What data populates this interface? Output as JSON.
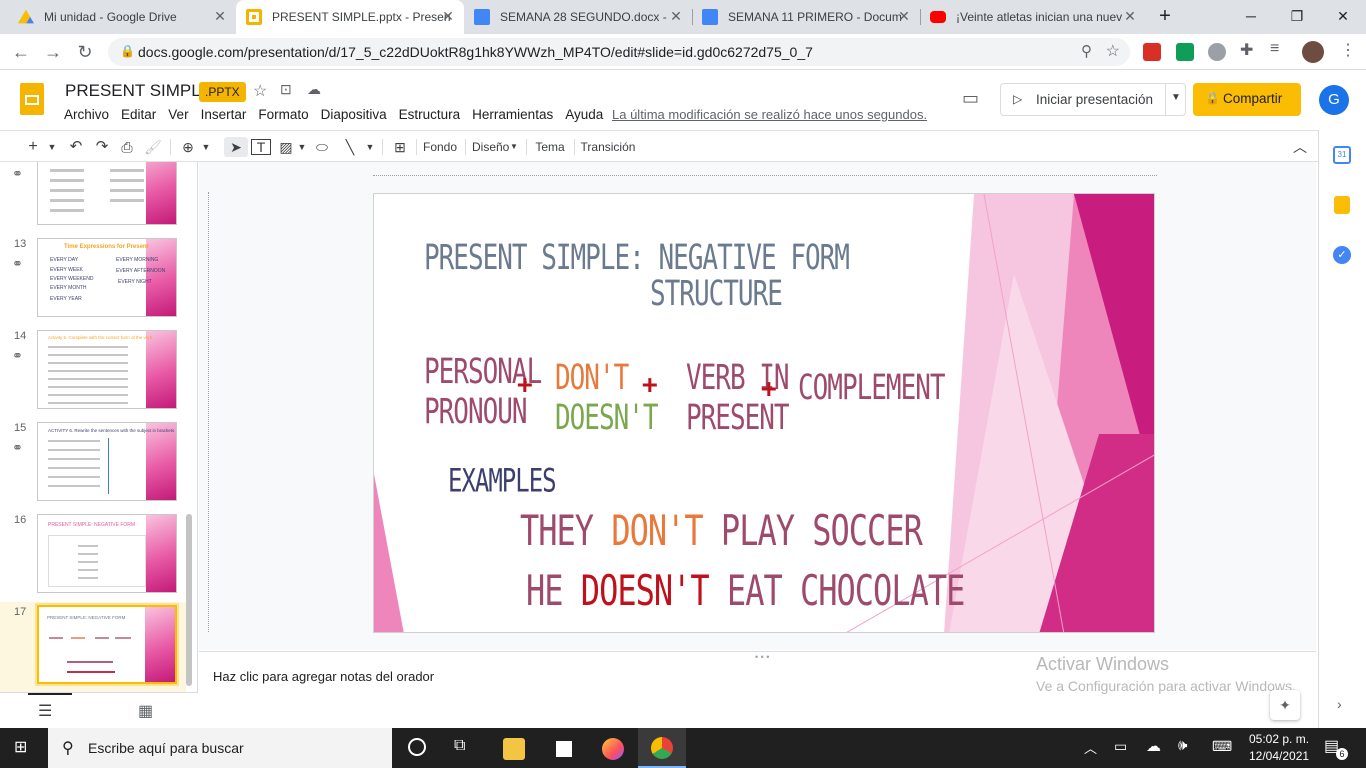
{
  "browser": {
    "tabs": [
      {
        "title": "Mi unidad - Google Drive",
        "icon": "google-drive-icon",
        "active": false
      },
      {
        "title": "PRESENT SIMPLE.pptx - Presen",
        "icon": "google-slides-icon",
        "active": true
      },
      {
        "title": "SEMANA 28 SEGUNDO.docx -",
        "icon": "google-docs-icon",
        "active": false
      },
      {
        "title": "SEMANA 11 PRIMERO - Docum",
        "icon": "google-docs-icon",
        "active": false
      },
      {
        "title": "¡Veinte atletas inician una nuev",
        "icon": "youtube-icon",
        "active": false
      }
    ],
    "new_tab": "+",
    "url": "docs.google.com/presentation/d/17_5_c22dDUoktR8g1hk8YWWzh_MP4TO/edit#slide=id.gd0c6272d75_0_7"
  },
  "doc": {
    "title": "PRESENT SIMPLE",
    "badge": ".PPTX",
    "menu": [
      "Archivo",
      "Editar",
      "Ver",
      "Insertar",
      "Formato",
      "Diapositiva",
      "Estructura",
      "Herramientas",
      "Ayuda"
    ],
    "last_edit": "La última modificación se realizó hace unos segundos.",
    "present_label": "Iniciar presentación",
    "share_label": "Compartir",
    "avatar_letter": "G"
  },
  "toolbar": {
    "fondo": "Fondo",
    "diseno": "Diseño",
    "tema": "Tema",
    "transicion": "Transición"
  },
  "filmstrip": {
    "slides": [
      {
        "number": "13",
        "title": "Time Expressions for Present",
        "col1": [
          "EVERY DAY",
          "EVERY WEEK",
          "EVERY WEEKEND",
          "EVERY MONTH",
          "EVERY YEAR"
        ],
        "col2": [
          "EVERY MORNING",
          "EVERY AFTERNOON",
          "EVERY NIGHT"
        ]
      },
      {
        "number": "14",
        "title": "Activity 5. Complete with the correct form of the verb"
      },
      {
        "number": "15",
        "title": "ACTIVITY 6. Rewrite the sentences with the subject in brackets"
      },
      {
        "number": "16",
        "title": "PRESENT SIMPLE: NEGATIVE FORM"
      },
      {
        "number": "17",
        "title": "PRESENT SIMPLE: NEGATIVE FORM"
      }
    ]
  },
  "slide": {
    "title_line1": "PRESENT SIMPLE: NEGATIVE FORM",
    "title_line2": "STRUCTURE",
    "personal": "PERSONAL",
    "pronoun": "PRONOUN",
    "plus": "+",
    "dont": "DON'T",
    "doesnt": "DOESN'T",
    "verb_in": "VERB IN",
    "present": "PRESENT",
    "complement": "COMPLEMENT",
    "examples": "EXAMPLES",
    "ex1_a": "THEY ",
    "ex1_b": "DON'T",
    "ex1_c": " PLAY SOCCER",
    "ex2_a": "HE ",
    "ex2_b": "DOESN'T",
    "ex2_c": " EAT CHOCOLATE",
    "colors": {
      "title": "#6b7a8f",
      "plum": "#9e4a6d",
      "orange": "#e8793a",
      "green": "#7aa84f",
      "red": "#c0101c",
      "navy": "#3c3f6e"
    }
  },
  "notes": {
    "placeholder": "Haz clic para agregar notas del orador"
  },
  "watermark": {
    "line1": "Activar Windows",
    "line2": "Ve a Configuración para activar Windows."
  },
  "taskbar": {
    "search_placeholder": "Escribe aquí para buscar",
    "time": "05:02 p. m.",
    "date": "12/04/2021",
    "notifications": "6"
  }
}
